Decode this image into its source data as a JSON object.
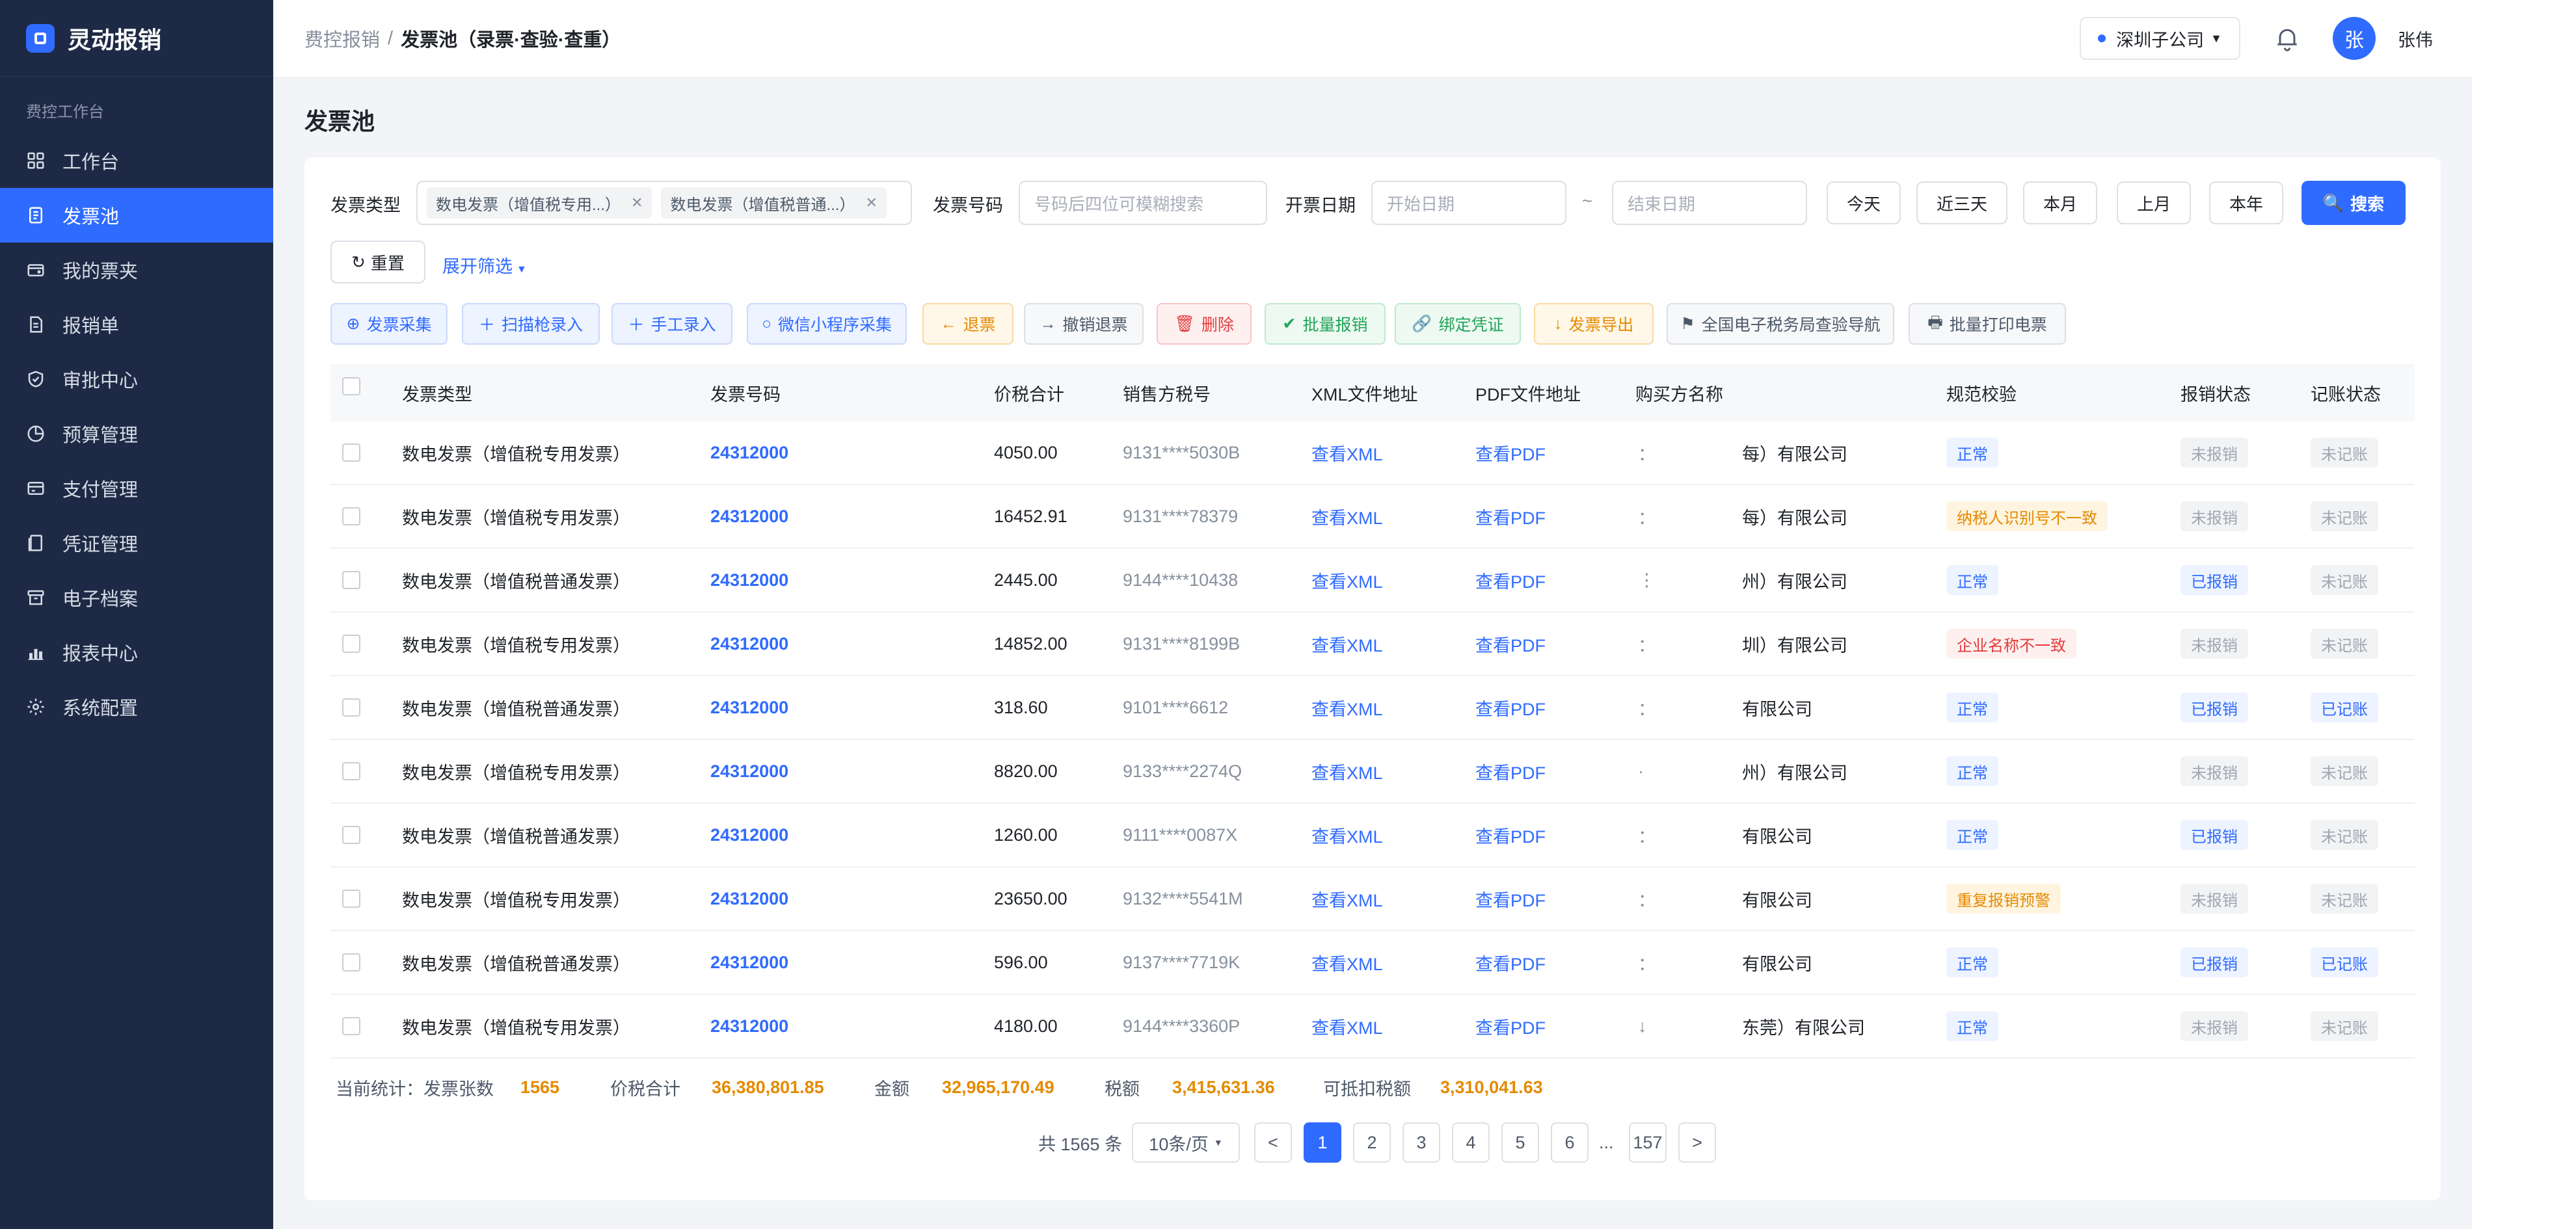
{
  "app": {
    "name": "灵动报销"
  },
  "sidebar": {
    "section_title": "费控工作台",
    "items": [
      {
        "label": "工作台",
        "icon": "grid-icon"
      },
      {
        "label": "发票池",
        "icon": "document-icon",
        "active": true
      },
      {
        "label": "我的票夹",
        "icon": "wallet-icon"
      },
      {
        "label": "报销单",
        "icon": "receipt-icon"
      },
      {
        "label": "审批中心",
        "icon": "shield-check-icon"
      },
      {
        "label": "预算管理",
        "icon": "pie-chart-icon"
      },
      {
        "label": "支付管理",
        "icon": "card-icon"
      },
      {
        "label": "凭证管理",
        "icon": "voucher-icon"
      },
      {
        "label": "电子档案",
        "icon": "archive-icon"
      },
      {
        "label": "报表中心",
        "icon": "bar-chart-icon"
      },
      {
        "label": "系统配置",
        "icon": "gear-icon"
      }
    ]
  },
  "header": {
    "breadcrumb_parent": "费控报销",
    "breadcrumb_sep": "/",
    "breadcrumb_current": "发票池（录票·查验·查重）",
    "company": "深圳子公司",
    "avatar_char": "张",
    "username": "张伟"
  },
  "page": {
    "title": "发票池"
  },
  "filters": {
    "type_label": "发票类型",
    "type_tags": [
      "数电发票（增值税专用...）",
      "数电发票（增值税普通...）"
    ],
    "number_label": "发票号码",
    "number_placeholder": "号码后四位可模糊搜索",
    "date_label": "开票日期",
    "date_start_placeholder": "开始日期",
    "date_sep": "~",
    "date_end_placeholder": "结束日期",
    "quick_dates": [
      "今天",
      "近三天",
      "本月",
      "上月",
      "本年"
    ],
    "search": "搜索",
    "reset": "重置",
    "expand": "展开筛选"
  },
  "actions": [
    {
      "label": "发票采集",
      "icon": "⊕",
      "style": "blue"
    },
    {
      "label": "扫描枪录入",
      "icon": "＋",
      "style": "blue"
    },
    {
      "label": "手工录入",
      "icon": "＋",
      "style": "blue"
    },
    {
      "label": "微信小程序采集",
      "icon": "○",
      "style": "blue"
    },
    {
      "label": "退票",
      "icon": "←",
      "style": "orange"
    },
    {
      "label": "撤销退票",
      "icon": "→",
      "style": "gray"
    },
    {
      "label": "删除",
      "icon": "🗑",
      "style": "red"
    },
    {
      "label": "批量报销",
      "icon": "✔",
      "style": "green"
    },
    {
      "label": "绑定凭证",
      "icon": "🔗",
      "style": "green"
    },
    {
      "label": "发票导出",
      "icon": "↓",
      "style": "orange"
    },
    {
      "label": "全国电子税务局查验导航",
      "icon": "⚑",
      "style": "gray"
    },
    {
      "label": "批量打印电票",
      "icon": "🖶",
      "style": "gray"
    }
  ],
  "table": {
    "columns": [
      "发票类型",
      "发票号码",
      "价税合计",
      "销售方税号",
      "XML文件地址",
      "PDF文件地址",
      "购买方名称",
      "规范校验",
      "报销状态",
      "记账状态"
    ],
    "rows": [
      {
        "type": "数电发票（增值税专用发票）",
        "code": "24312000",
        "amount": "4050.00",
        "tax_id": "9131****5030B",
        "xml": "查看XML",
        "pdf": "查看PDF",
        "buyer_a": "：",
        "buyer_b": "每）有限公司",
        "check": "正常",
        "check_style": "blue",
        "reimb": "未报销",
        "reimb_style": "gray",
        "book": "未记账",
        "book_style": "gray"
      },
      {
        "type": "数电发票（增值税专用发票）",
        "code": "24312000",
        "amount": "16452.91",
        "tax_id": "9131****78379",
        "xml": "查看XML",
        "pdf": "查看PDF",
        "buyer_a": "：",
        "buyer_b": "每）有限公司",
        "check": "纳税人识别号不一致",
        "check_style": "orange",
        "reimb": "未报销",
        "reimb_style": "gray",
        "book": "未记账",
        "book_style": "gray"
      },
      {
        "type": "数电发票（增值税普通发票）",
        "code": "24312000",
        "amount": "2445.00",
        "tax_id": "9144****10438",
        "xml": "查看XML",
        "pdf": "查看PDF",
        "buyer_a": "⋮",
        "buyer_b": "州）有限公司",
        "check": "正常",
        "check_style": "blue",
        "reimb": "已报销",
        "reimb_style": "blue",
        "book": "未记账",
        "book_style": "gray"
      },
      {
        "type": "数电发票（增值税专用发票）",
        "code": "24312000",
        "amount": "14852.00",
        "tax_id": "9131****8199B",
        "xml": "查看XML",
        "pdf": "查看PDF",
        "buyer_a": "：",
        "buyer_b": "圳）有限公司",
        "check": "企业名称不一致",
        "check_style": "red",
        "reimb": "未报销",
        "reimb_style": "gray",
        "book": "未记账",
        "book_style": "gray"
      },
      {
        "type": "数电发票（增值税普通发票）",
        "code": "24312000",
        "amount": "318.60",
        "tax_id": "9101****6612",
        "xml": "查看XML",
        "pdf": "查看PDF",
        "buyer_a": "：",
        "buyer_b": "有限公司",
        "check": "正常",
        "check_style": "blue",
        "reimb": "已报销",
        "reimb_style": "blue",
        "book": "已记账",
        "book_style": "blue"
      },
      {
        "type": "数电发票（增值税专用发票）",
        "code": "24312000",
        "amount": "8820.00",
        "tax_id": "9133****2274Q",
        "xml": "查看XML",
        "pdf": "查看PDF",
        "buyer_a": "·",
        "buyer_b": "州）有限公司",
        "check": "正常",
        "check_style": "blue",
        "reimb": "未报销",
        "reimb_style": "gray",
        "book": "未记账",
        "book_style": "gray"
      },
      {
        "type": "数电发票（增值税普通发票）",
        "code": "24312000",
        "amount": "1260.00",
        "tax_id": "9111****0087X",
        "xml": "查看XML",
        "pdf": "查看PDF",
        "buyer_a": "：",
        "buyer_b": "有限公司",
        "check": "正常",
        "check_style": "blue",
        "reimb": "已报销",
        "reimb_style": "blue",
        "book": "未记账",
        "book_style": "gray"
      },
      {
        "type": "数电发票（增值税专用发票）",
        "code": "24312000",
        "amount": "23650.00",
        "tax_id": "9132****5541M",
        "xml": "查看XML",
        "pdf": "查看PDF",
        "buyer_a": "：",
        "buyer_b": "有限公司",
        "check": "重复报销预警",
        "check_style": "orange",
        "reimb": "未报销",
        "reimb_style": "gray",
        "book": "未记账",
        "book_style": "gray"
      },
      {
        "type": "数电发票（增值税普通发票）",
        "code": "24312000",
        "amount": "596.00",
        "tax_id": "9137****7719K",
        "xml": "查看XML",
        "pdf": "查看PDF",
        "buyer_a": "：",
        "buyer_b": "有限公司",
        "check": "正常",
        "check_style": "blue",
        "reimb": "已报销",
        "reimb_style": "blue",
        "book": "已记账",
        "book_style": "blue"
      },
      {
        "type": "数电发票（增值税专用发票）",
        "code": "24312000",
        "amount": "4180.00",
        "tax_id": "9144****3360P",
        "xml": "查看XML",
        "pdf": "查看PDF",
        "buyer_a": "↓",
        "buyer_b": "东莞）有限公司",
        "check": "正常",
        "check_style": "blue",
        "reimb": "未报销",
        "reimb_style": "gray",
        "book": "未记账",
        "book_style": "gray"
      }
    ]
  },
  "summary": {
    "prefix": "当前统计：",
    "count_label": "发票张数",
    "count": "1565",
    "total_label": "价税合计",
    "total": "36,380,801.85",
    "amount_label": "金额",
    "amount": "32,965,170.49",
    "tax_label": "税额",
    "tax": "3,415,631.36",
    "deductible_label": "可抵扣税额",
    "deductible": "3,310,041.63"
  },
  "pagination": {
    "total_text": "共 1565 条",
    "page_size": "10条/页",
    "prev": "<",
    "next": ">",
    "pages": [
      "1",
      "2",
      "3",
      "4",
      "5",
      "6"
    ],
    "ellipsis": "...",
    "last": "157",
    "current": "1"
  },
  "colors": {
    "primary": "#2f6bff",
    "sidebar_bg": "#1e2a45",
    "warning": "#e58a00",
    "danger": "#e23c3c",
    "success": "#21a35a"
  }
}
